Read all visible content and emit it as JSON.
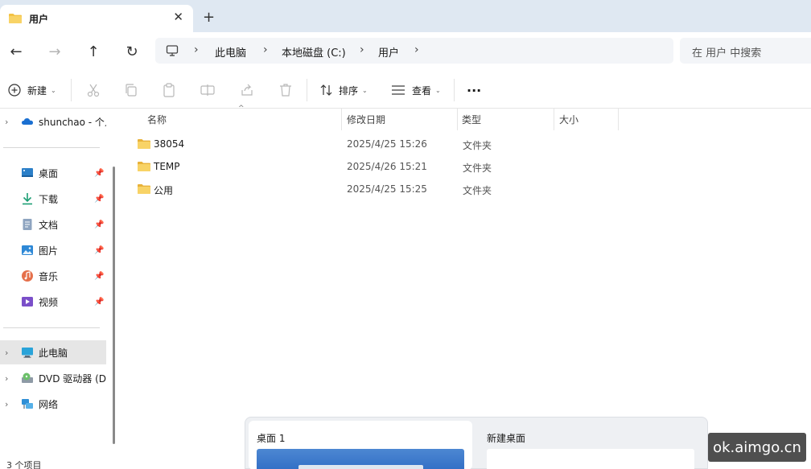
{
  "window": {
    "tab_title": "用户",
    "close_glyph": "✕",
    "new_tab_glyph": "+"
  },
  "nav": {
    "back": "←",
    "forward": "→",
    "up": "↑",
    "refresh": "↻",
    "separator": "›",
    "breadcrumbs": [
      "此电脑",
      "本地磁盘 (C:)",
      "用户"
    ],
    "search_placeholder": "在 用户 中搜索"
  },
  "toolbar": {
    "new_label": "新建",
    "sort_label": "排序",
    "view_label": "查看",
    "more_label": "···",
    "caret": "⌄"
  },
  "navpane": {
    "chevron": "›",
    "pin": "📌",
    "onedrive": "shunchao - 个人",
    "quick_access": [
      {
        "label": "桌面",
        "icon": "desktop-icon"
      },
      {
        "label": "下载",
        "icon": "download-icon"
      },
      {
        "label": "文档",
        "icon": "documents-icon"
      },
      {
        "label": "图片",
        "icon": "pictures-icon"
      },
      {
        "label": "音乐",
        "icon": "music-icon"
      },
      {
        "label": "视频",
        "icon": "videos-icon"
      }
    ],
    "this_pc": "此电脑",
    "dvd": "DVD 驱动器 (D",
    "network": "网络"
  },
  "filelist": {
    "columns": [
      "名称",
      "修改日期",
      "类型",
      "大小"
    ],
    "rows": [
      {
        "name": "38054",
        "date": "2025/4/25 15:26",
        "type": "文件夹"
      },
      {
        "name": "TEMP",
        "date": "2025/4/26 15:21",
        "type": "文件夹"
      },
      {
        "name": "公用",
        "date": "2025/4/25 15:25",
        "type": "文件夹"
      }
    ]
  },
  "status": {
    "item_count": "3 个项目"
  },
  "taskview": {
    "desktop1": "桌面 1",
    "new_desktop": "新建桌面"
  },
  "watermark": "ok.aimgo.cn",
  "colors": {
    "folder": "#f3c244",
    "accent": "#0067c0"
  }
}
